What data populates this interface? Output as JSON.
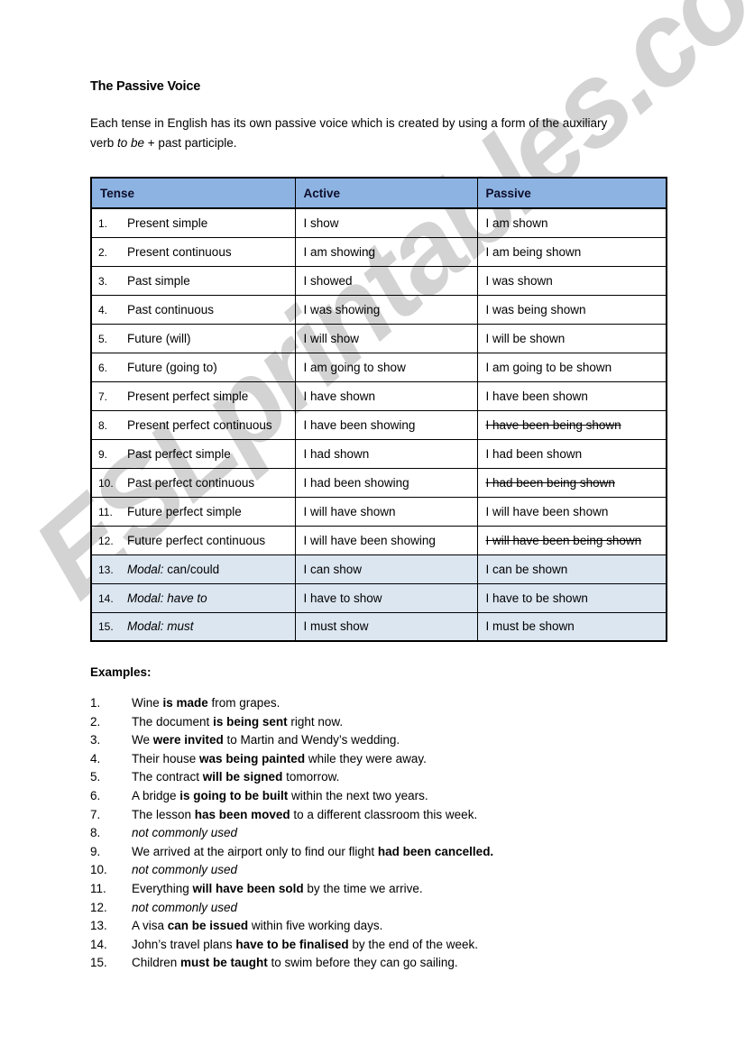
{
  "document": {
    "title": "The Passive Voice",
    "intro_before_italic": "Each tense in English has its own passive voice which is created by using a form of the auxiliary verb ",
    "intro_italic": "to be",
    "intro_after_italic": " + past participle."
  },
  "watermark": {
    "text": "ESLprintables.com",
    "color": "#cccccc"
  },
  "table": {
    "header": {
      "tense": "Tense",
      "active": "Active",
      "passive": "Passive",
      "background_color": "#8db3e2",
      "text_color": "#0d0d2b"
    },
    "modal_row_background": "#dce6f1",
    "rows": [
      {
        "num": "1.",
        "tense": "Present simple",
        "active": "I show",
        "passive": "I am shown",
        "passive_struck": false,
        "modal": false,
        "group_end": false
      },
      {
        "num": "2.",
        "tense": "Present continuous",
        "active": "I am showing",
        "passive": "I am being shown",
        "passive_struck": false,
        "modal": false,
        "group_end": true
      },
      {
        "num": "3.",
        "tense": "Past simple",
        "active": "I showed",
        "passive": "I was shown",
        "passive_struck": false,
        "modal": false,
        "group_end": false
      },
      {
        "num": "4.",
        "tense": "Past continuous",
        "active": "I was showing",
        "passive": "I was being shown",
        "passive_struck": false,
        "modal": false,
        "group_end": true
      },
      {
        "num": "5.",
        "tense": "Future (will)",
        "active": "I will show",
        "passive": "I will be shown",
        "passive_struck": false,
        "modal": false,
        "group_end": false
      },
      {
        "num": "6.",
        "tense": "Future (going to)",
        "active": "I am going to show",
        "passive": "I am going to be shown",
        "passive_struck": false,
        "modal": false,
        "group_end": true
      },
      {
        "num": "7.",
        "tense": "Present perfect simple",
        "active": "I have shown",
        "passive": "I have been shown",
        "passive_struck": false,
        "modal": false,
        "group_end": false
      },
      {
        "num": "8.",
        "tense": "Present perfect continuous",
        "active": "I have been showing",
        "passive": "I have been being shown",
        "passive_struck": true,
        "modal": false,
        "group_end": true
      },
      {
        "num": "9.",
        "tense": "Past perfect simple",
        "active": "I had shown",
        "passive": "I had been shown",
        "passive_struck": false,
        "modal": false,
        "group_end": false
      },
      {
        "num": "10.",
        "tense": "Past perfect continuous",
        "active": "I had been showing",
        "passive": "I had been being shown",
        "passive_struck": true,
        "modal": false,
        "group_end": true
      },
      {
        "num": "11.",
        "tense": "Future perfect simple",
        "active": "I will have shown",
        "passive": "I will have been shown",
        "passive_struck": false,
        "modal": false,
        "group_end": false
      },
      {
        "num": "12.",
        "tense": "Future perfect continuous",
        "active": "I will have been showing",
        "passive": "I will have been being shown",
        "passive_struck": true,
        "modal": false,
        "group_end": true
      },
      {
        "num": "13.",
        "tense": "can/could",
        "tense_lead": "Modal:",
        "active": "I can show",
        "passive": "I can be shown",
        "passive_struck": false,
        "modal": true,
        "group_end": false
      },
      {
        "num": "14.",
        "tense": "have to",
        "tense_lead": "Modal:",
        "active": "I have to show",
        "passive": "I have to be shown",
        "passive_struck": false,
        "modal": true,
        "group_end": false,
        "tense_italic": true
      },
      {
        "num": "15.",
        "tense": "must",
        "tense_lead": "Modal:",
        "active": "I must show",
        "passive": "I must be shown",
        "passive_struck": false,
        "modal": true,
        "group_end": false,
        "tense_italic": true
      }
    ]
  },
  "examples": {
    "title": "Examples:",
    "items": [
      {
        "num": "1.",
        "before": "Wine ",
        "bold": "is made",
        "after": " from grapes.",
        "not_used": false
      },
      {
        "num": "2.",
        "before": "The document ",
        "bold": "is being sent",
        "after": " right now.",
        "not_used": false
      },
      {
        "num": "3.",
        "before": "We ",
        "bold": "were invited",
        "after": " to Martin and Wendy’s wedding.",
        "not_used": false
      },
      {
        "num": "4.",
        "before": "Their house ",
        "bold": "was being painted",
        "after": " while they were away.",
        "not_used": false
      },
      {
        "num": "5.",
        "before": "The contract ",
        "bold": "will be signed",
        "after": " tomorrow.",
        "not_used": false
      },
      {
        "num": "6.",
        "before": "A bridge ",
        "bold": "is going to be built",
        "after": " within the next two years.",
        "not_used": false
      },
      {
        "num": "7.",
        "before": "The lesson ",
        "bold": "has been moved",
        "after": " to a different classroom this week.",
        "not_used": false
      },
      {
        "num": "8.",
        "before": "",
        "bold": "",
        "after": "not commonly used",
        "not_used": true
      },
      {
        "num": "9.",
        "before": "We arrived at the airport only to find our flight ",
        "bold": "had been cancelled.",
        "after": "",
        "not_used": false
      },
      {
        "num": "10.",
        "before": "",
        "bold": "",
        "after": "not commonly used",
        "not_used": true
      },
      {
        "num": "11.",
        "before": "Everything ",
        "bold": "will have been sold",
        "after": " by the time we arrive.",
        "not_used": false
      },
      {
        "num": "12.",
        "before": "",
        "bold": "",
        "after": "not commonly used",
        "not_used": true
      },
      {
        "num": "13.",
        "before": "A visa ",
        "bold": "can be issued",
        "after": " within five working days.",
        "not_used": false
      },
      {
        "num": "14.",
        "before": "John’s travel plans ",
        "bold": "have to be finalised",
        "after": " by the end of the week.",
        "not_used": false
      },
      {
        "num": "15.",
        "before": "Children ",
        "bold": "must be taught",
        "after": " to swim before they can go sailing.",
        "not_used": false
      }
    ]
  }
}
